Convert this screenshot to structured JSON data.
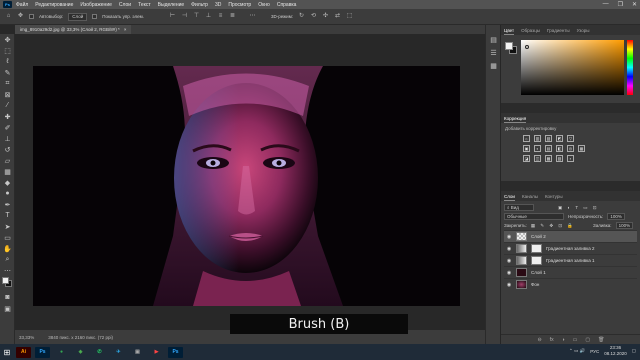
{
  "menubar": {
    "logo": "Ps",
    "items": [
      "Файл",
      "Редактирование",
      "Изображение",
      "Слои",
      "Текст",
      "Выделение",
      "Фильтр",
      "3D",
      "Просмотр",
      "Окно",
      "Справка"
    ],
    "window_controls": [
      "—",
      "❐",
      "✕"
    ]
  },
  "options": {
    "autoselect_label": "Автовыбор:",
    "autoselect_value": "Слой",
    "show_controls": "Показать упр. элем.",
    "mode_3d": "3D-режим:"
  },
  "document": {
    "tab_title": "img_8910a29d2.jpg @ 33,3% (Слой 2, RGB/8#) *",
    "tab_close": "×"
  },
  "status": {
    "zoom": "33,33%",
    "size": "3840 пикс. x 2160 пикс. (72 ppi)"
  },
  "caption": "Brush (B)",
  "color_panel": {
    "tabs": [
      "Цвет",
      "Образцы",
      "Градиенты",
      "Узоры"
    ],
    "active_tab": 0,
    "fg_color": "#f2f2f2",
    "bg_color": "#111111",
    "hue_base": "#ff9c00"
  },
  "adjustments": {
    "title": "Коррекция",
    "subtitle": "Добавить корректировку",
    "row1": [
      "☼",
      "▥",
      "▨",
      "◩",
      "▽"
    ],
    "row2": [
      "▣",
      "◐",
      "▤",
      "◧",
      "◎",
      "▦"
    ],
    "row3": [
      "◪",
      "◫",
      "▩",
      "▧",
      "▪"
    ]
  },
  "layers_panel": {
    "tabs": [
      "Слои",
      "Каналы",
      "Контуры"
    ],
    "active_tab": 0,
    "filter_label": "Вид",
    "blend_mode": "Обычные",
    "opacity_label": "Непрозрачность:",
    "opacity_value": "100%",
    "lock_label": "Закрепить:",
    "fill_label": "Заливка:",
    "fill_value": "100%",
    "layers": [
      {
        "name": "Слой 2",
        "selected": true,
        "thumb": "#c9c9c9"
      },
      {
        "name": "Градиентная заливка 2",
        "selected": false,
        "thumb": "#efefef"
      },
      {
        "name": "Градиентная заливка 1",
        "selected": false,
        "thumb": "#efefef"
      },
      {
        "name": "Слой 1",
        "selected": false,
        "thumb": "#2a0a14"
      },
      {
        "name": "Фон",
        "selected": false,
        "thumb": "#4a1a2a"
      }
    ],
    "footer_icons": [
      "⊖",
      "fx",
      "◑",
      "▭",
      "▢",
      "🗑"
    ]
  },
  "taskbar": {
    "apps": [
      {
        "label": "Ai",
        "color": "#330000",
        "text": "#ff9a00"
      },
      {
        "label": "Ps",
        "color": "#001e36",
        "text": "#31a8ff"
      },
      {
        "label": "●",
        "color": "#1f2b38",
        "text": "#34a853"
      },
      {
        "label": "◈",
        "color": "#1f2b38",
        "text": "#4caf50"
      },
      {
        "label": "✆",
        "color": "#1f2b38",
        "text": "#25d366"
      },
      {
        "label": "✈",
        "color": "#1f2b38",
        "text": "#2ca5e0"
      },
      {
        "label": "▣",
        "color": "#1f2b38",
        "text": "#aaaaaa"
      },
      {
        "label": "▶",
        "color": "#1f2b38",
        "text": "#ff4444"
      },
      {
        "label": "Ps",
        "color": "#001e36",
        "text": "#31a8ff"
      }
    ],
    "lang": "РУС",
    "time": "23:36",
    "date": "08.12.2020"
  }
}
